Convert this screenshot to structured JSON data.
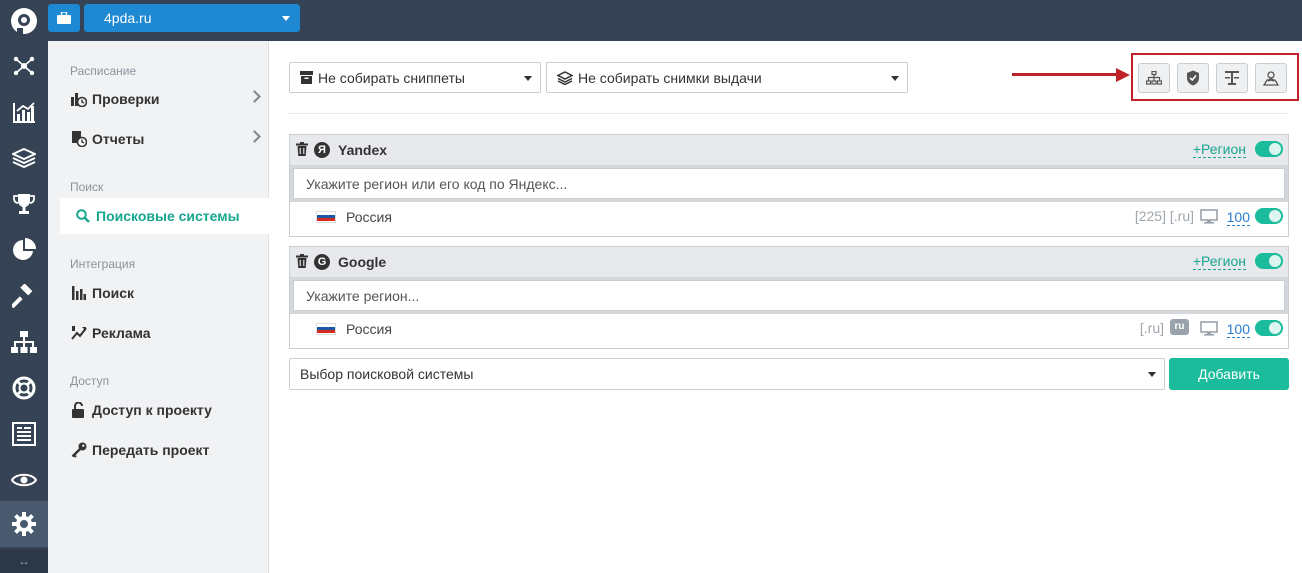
{
  "topbar": {
    "project_name": "4pda.ru"
  },
  "rail": {
    "items": [
      "nodes-icon",
      "chart-icon",
      "layers-icon",
      "trophy-icon",
      "pie-icon",
      "hammer-icon",
      "sitemap-icon",
      "lifebuoy-icon",
      "report-icon",
      "eye-icon",
      "gear-icon"
    ],
    "bottom_glyph": "↔"
  },
  "subnav": {
    "sections": [
      {
        "heading": "Расписание",
        "items": [
          "Проверки",
          "Отчеты"
        ]
      },
      {
        "heading": "Поиск",
        "items": [
          "Поисковые системы"
        ]
      },
      {
        "heading": "Интеграция",
        "items": [
          "Поиск",
          "Реклама"
        ]
      },
      {
        "heading": "Доступ",
        "items": [
          "Доступ к проекту",
          "Передать проект"
        ]
      }
    ]
  },
  "main": {
    "snippets_select": "Не собирать сниппеты",
    "screenshots_select": "Не собирать снимки выдачи",
    "add_region_label": "+Регион",
    "engines": [
      {
        "name": "Yandex",
        "logo_letter": "Я",
        "region_placeholder": "Укажите регион или его код по Яндекс...",
        "region_name": "Россия",
        "region_code": "[225] [.ru]",
        "limit": "100"
      },
      {
        "name": "Google",
        "logo_letter": "G",
        "region_placeholder": "Укажите регион...",
        "region_name": "Россия",
        "region_code": "[.ru]",
        "lang_badge": "ru",
        "limit": "100"
      }
    ],
    "engine_select": "Выбор поисковой системы",
    "add_button": "Добавить"
  },
  "colors": {
    "topbar": "#354355",
    "accent_blue": "#1e88d3",
    "accent_green": "#1abc9c",
    "highlight_red": "#c0202a"
  }
}
